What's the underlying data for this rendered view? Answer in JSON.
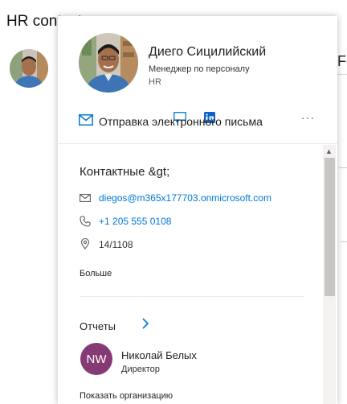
{
  "background": {
    "title": "HR contacts",
    "right_partial": "Fo"
  },
  "card": {
    "name": "Диего Сицилийский",
    "role": "Менеджер по персоналу",
    "department": "HR",
    "actions": {
      "send_email_label": "Отправка электронного письма",
      "more_label": "···"
    },
    "contact": {
      "heading": "Контактные &gt;",
      "email": "diegos@m365x177703.onmicrosoft.com",
      "phone": "+1 205 555 0108",
      "location": "14/1108",
      "more_link": "Больше"
    },
    "reports": {
      "heading": "Отчеты",
      "person": {
        "initials": "NW",
        "name": "Николай Белых",
        "title": "Директор"
      },
      "show_org": "Показать организацию"
    }
  },
  "colors": {
    "accent": "#0078d4",
    "avatar_nw": "#863a75"
  }
}
